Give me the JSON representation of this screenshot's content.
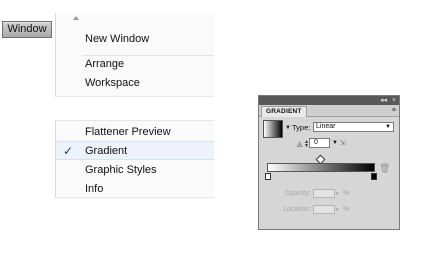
{
  "window_menu": {
    "label": "Window"
  },
  "menu_top": {
    "items": [
      {
        "label": "New Window"
      },
      {
        "label": "Arrange"
      },
      {
        "label": "Workspace"
      }
    ]
  },
  "menu_bottom": {
    "items": [
      {
        "label": "Flattener Preview",
        "checked": false
      },
      {
        "label": "Gradient",
        "checked": true
      },
      {
        "label": "Graphic Styles",
        "checked": false
      },
      {
        "label": "Info",
        "checked": false
      }
    ],
    "check_glyph": "✓"
  },
  "gradient_panel": {
    "tab_label": "GRADIENT",
    "collapse_glyph": "◂◂",
    "close_glyph": "×",
    "type_label": "Type:",
    "type_value": "Linear",
    "angle_value": "0",
    "opacity_label": "Opacity:",
    "location_label": "Location:",
    "percent": "%",
    "colors": {
      "background": "#d6d6d6",
      "titlebar": "#585858"
    }
  }
}
